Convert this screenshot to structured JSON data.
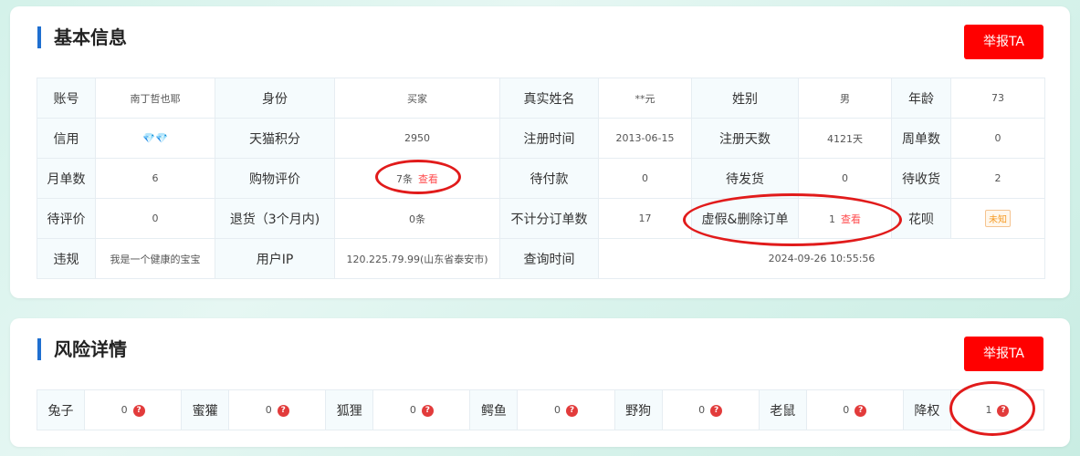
{
  "basic": {
    "title": "基本信息",
    "report_label": "举报TA",
    "rows": [
      [
        {
          "type": "label",
          "text": "账号"
        },
        {
          "type": "value",
          "text": "南丁哲也耶"
        },
        {
          "type": "label",
          "text": "身份"
        },
        {
          "type": "value",
          "text": "买家"
        },
        {
          "type": "label",
          "text": "真实姓名"
        },
        {
          "type": "value",
          "text": "**元"
        },
        {
          "type": "label",
          "text": "姓别"
        },
        {
          "type": "value",
          "text": "男"
        },
        {
          "type": "label",
          "text": "年龄"
        },
        {
          "type": "value",
          "text": "73"
        }
      ],
      [
        {
          "type": "label",
          "text": "信用"
        },
        {
          "type": "diamonds",
          "text": "💎💎",
          "icon": "diamond-icon"
        },
        {
          "type": "label",
          "text": "天猫积分"
        },
        {
          "type": "value",
          "text": "2950"
        },
        {
          "type": "label",
          "text": "注册时间"
        },
        {
          "type": "value",
          "text": "2013-06-15"
        },
        {
          "type": "label",
          "text": "注册天数"
        },
        {
          "type": "value",
          "text": "4121天"
        },
        {
          "type": "label",
          "text": "周单数"
        },
        {
          "type": "value",
          "text": "0"
        }
      ],
      [
        {
          "type": "label",
          "text": "月单数"
        },
        {
          "type": "value",
          "text": "6"
        },
        {
          "type": "label",
          "text": "购物评价"
        },
        {
          "type": "link",
          "text": "7条",
          "link": "查看"
        },
        {
          "type": "label",
          "text": "待付款"
        },
        {
          "type": "value",
          "text": "0"
        },
        {
          "type": "label",
          "text": "待发货"
        },
        {
          "type": "value",
          "text": "0"
        },
        {
          "type": "label",
          "text": "待收货"
        },
        {
          "type": "value",
          "text": "2"
        }
      ],
      [
        {
          "type": "label",
          "text": "待评价"
        },
        {
          "type": "value",
          "text": "0"
        },
        {
          "type": "label",
          "text": "退货（3个月内)"
        },
        {
          "type": "value",
          "text": "0条"
        },
        {
          "type": "label",
          "text": "不计分订单数"
        },
        {
          "type": "value",
          "text": "17"
        },
        {
          "type": "label",
          "text": "虚假&删除订单"
        },
        {
          "type": "link",
          "text": "1",
          "link": "查看"
        },
        {
          "type": "label",
          "text": "花呗"
        },
        {
          "type": "tag",
          "text": "未知"
        }
      ],
      [
        {
          "type": "label",
          "text": "违规"
        },
        {
          "type": "value",
          "text": "我是一个健康的宝宝"
        },
        {
          "type": "label",
          "text": "用户IP"
        },
        {
          "type": "value",
          "text": "120.225.79.99(山东省泰安市)"
        },
        {
          "type": "label",
          "text": "查询时间"
        },
        {
          "type": "value",
          "text": "2024-09-26 10:55:56",
          "colspan": 5
        }
      ]
    ]
  },
  "risk": {
    "title": "风险详情",
    "report_label": "举报TA",
    "items": [
      {
        "label": "兔子",
        "value": "0"
      },
      {
        "label": "蜜獾",
        "value": "0"
      },
      {
        "label": "狐狸",
        "value": "0"
      },
      {
        "label": "鳄鱼",
        "value": "0"
      },
      {
        "label": "野狗",
        "value": "0"
      },
      {
        "label": "老鼠",
        "value": "0"
      },
      {
        "label": "降权",
        "value": "1"
      }
    ],
    "help_glyph": "?"
  },
  "colors": {
    "accent_bar": "#1f6fd0",
    "report_button": "#ff0000",
    "annotation": "#e11b1b",
    "link": "#ff4d4f"
  }
}
